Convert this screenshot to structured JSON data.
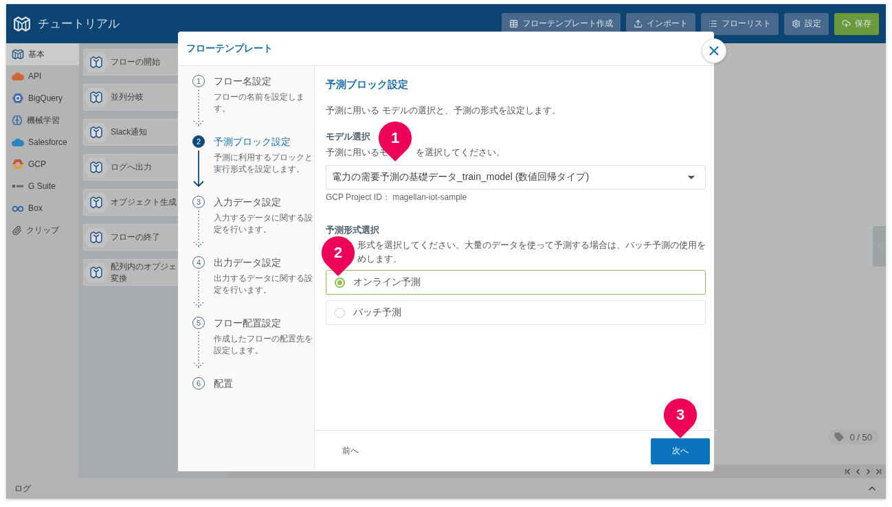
{
  "app": {
    "title": "チュートリアル",
    "toolbar": [
      {
        "label": "フローテンプレート作成",
        "kind": "template"
      },
      {
        "label": "インポート",
        "kind": "import"
      },
      {
        "label": "フローリスト",
        "kind": "list"
      },
      {
        "label": "設定",
        "kind": "settings"
      },
      {
        "label": "保存",
        "kind": "save"
      }
    ]
  },
  "sidebar": {
    "items": [
      {
        "label": "基本",
        "kind": "basic",
        "selected": true
      },
      {
        "label": "API",
        "kind": "api",
        "selected": false
      },
      {
        "label": "BigQuery",
        "kind": "bigquery",
        "selected": false
      },
      {
        "label": "機械学習",
        "kind": "ml",
        "selected": false
      },
      {
        "label": "Salesforce",
        "kind": "salesforce",
        "selected": false
      },
      {
        "label": "GCP",
        "kind": "gcp",
        "selected": false
      },
      {
        "label": "G Suite",
        "kind": "gsuite",
        "selected": false
      },
      {
        "label": "Box",
        "kind": "box",
        "selected": false
      },
      {
        "label": "クリップ",
        "kind": "clip",
        "selected": false
      }
    ]
  },
  "palette": {
    "items": [
      {
        "label": "フローの開始"
      },
      {
        "label": "並列分岐"
      },
      {
        "label": "Slack通知"
      },
      {
        "label": "ログへ出力"
      },
      {
        "label": "オブジェクト生成"
      },
      {
        "label": "フローの終了"
      },
      {
        "label": "配列内のオブジェ変換"
      }
    ]
  },
  "canvas": {
    "counter": "0 / 50"
  },
  "log_bar": {
    "label": "ログ"
  },
  "modal": {
    "title": "フローテンプレート",
    "steps": [
      {
        "number": "1",
        "title": "フロー名設定",
        "description": "フローの名前を設定します。",
        "selected": false
      },
      {
        "number": "2",
        "title": "予測ブロック設定",
        "description": "予測に利用するブロックと実行形式を設定します。",
        "selected": true
      },
      {
        "number": "3",
        "title": "入力データ設定",
        "description": "入力するデータに関する設定を行います。",
        "selected": false
      },
      {
        "number": "4",
        "title": "出力データ設定",
        "description": "出力するデータに関する設定を行います。",
        "selected": false
      },
      {
        "number": "5",
        "title": "フロー配置設定",
        "description": "作成したフローの配置先を設定します。",
        "selected": false
      },
      {
        "number": "6",
        "title": "配置",
        "selected": false
      }
    ],
    "content": {
      "title": "予測ブロック設定",
      "description": "予測に用いる モデルの選択と、予測の形式を設定します。",
      "model": {
        "label": "モデル選択",
        "hint_parts": [
          "予測に用いるモ",
          "を選択してください。"
        ],
        "marker": "1",
        "value": "電力の需要予測の基礎データ_train_model (数値回帰タイプ)",
        "project_id": "GCP Project ID： magellan-iot-sample"
      },
      "format": {
        "label": "予測形式選択",
        "hint_lines": [
          "形式を選択してください。大量のデータを使って予測する場合は、バッチ予測の使用を",
          "めします。"
        ],
        "marker": "2",
        "options": [
          {
            "label": "オンライン予測",
            "selected": true
          },
          {
            "label": "バッチ予測",
            "selected": false
          }
        ]
      }
    },
    "footer": {
      "back": "前へ",
      "next": "次へ",
      "marker": "3"
    }
  }
}
